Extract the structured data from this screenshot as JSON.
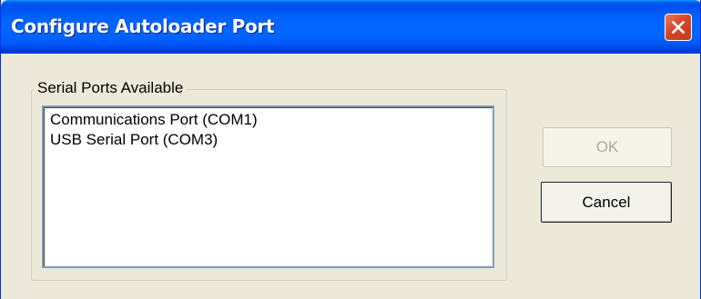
{
  "window": {
    "title": "Configure Autoloader Port",
    "close_icon": "close-icon"
  },
  "group": {
    "label": "Serial Ports Available"
  },
  "ports": [
    "Communications Port (COM1)",
    "USB Serial Port (COM3)"
  ],
  "buttons": {
    "ok_label": "OK",
    "ok_enabled": false,
    "cancel_label": "Cancel"
  },
  "colors": {
    "titlebar": "#0058ee",
    "close_button": "#d7462a",
    "dialog_background": "#ece9d8",
    "disabled_text": "#aca899"
  }
}
